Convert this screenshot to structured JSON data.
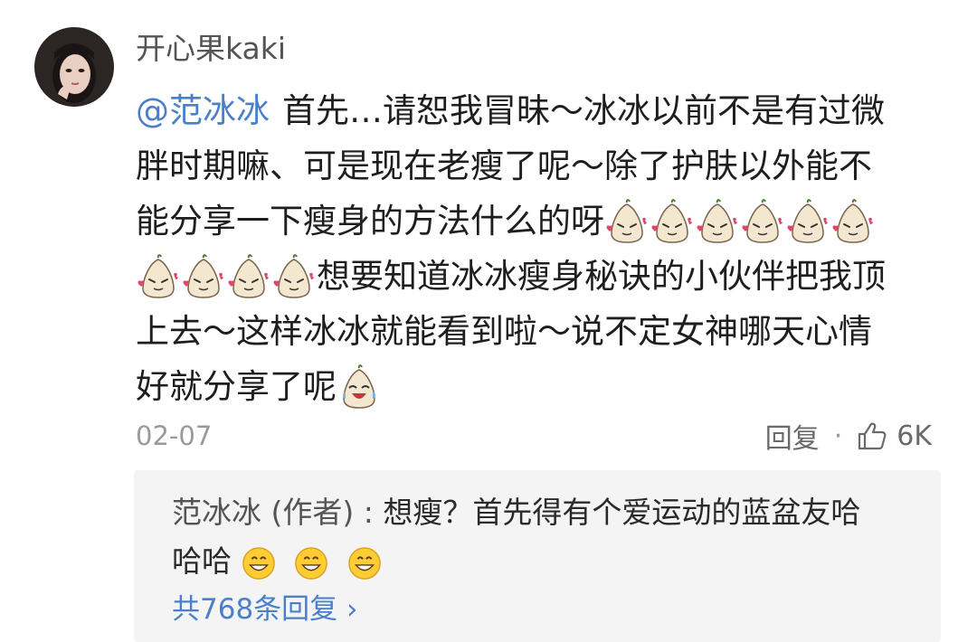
{
  "comment": {
    "username": "开心果kaki",
    "mention": "@范冰冰",
    "line1": "首先…请恕我冒昧～冰冰以前不是有过微",
    "line2": "胖时期嘛、可是现在老瘦了呢～除了护肤以外能不",
    "line3": "能分享一下瘦身的方法什么的呀",
    "line4": "想要知道冰冰瘦身秘诀的小伙伴把我顶",
    "line5": "上去～这样冰冰就能看到啦～说不定女神哪天心情",
    "line6": "好就分享了呢",
    "date": "02-07",
    "reply_label": "回复",
    "separator": "·",
    "like_count": "6K"
  },
  "author_reply": {
    "author": "范冰冰 (作者) : ",
    "text1": "想瘦？首先得有个爱运动的蓝盆友哈",
    "text2": "哈哈",
    "more_label": "共768条回复",
    "more_chevron": "›"
  },
  "icons": {
    "emoji": "doge-bean-emoji",
    "laugh": "crying-laugh-emoji",
    "smile": "grin-emoji",
    "like": "thumbs-up-icon"
  },
  "colors": {
    "accent": "#4a80c9",
    "text": "#1e1e1e",
    "meta": "#9a9a9a",
    "reply_bg": "#f4f4f4"
  }
}
